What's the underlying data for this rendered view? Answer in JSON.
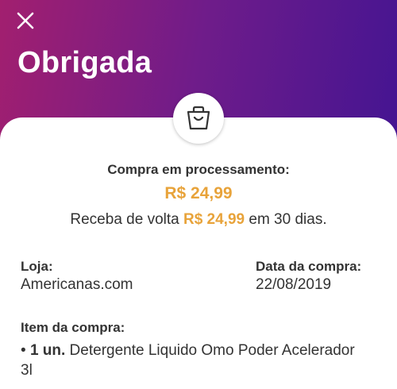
{
  "header": {
    "title": "Obrigada"
  },
  "status": {
    "label": "Compra em processamento:",
    "amount": "R$ 24,99"
  },
  "cashback": {
    "prefix": "Receba de volta ",
    "amount": "R$ 24,99",
    "suffix": " em 30 dias."
  },
  "store": {
    "label": "Loja:",
    "value": "Americanas.com"
  },
  "purchase_date": {
    "label": "Data da compra:",
    "value": "22/08/2019"
  },
  "item": {
    "label": "Item da compra:",
    "bullet": "•",
    "quantity": "1 un.",
    "description": " Detergente Liquido Omo Poder Acelerador 3l"
  },
  "icons": {
    "close": "close-icon",
    "bag": "shopping-bag-icon"
  },
  "colors": {
    "gradient_start": "#a21f6f",
    "gradient_end": "#3c1393",
    "accent": "#e8a33a",
    "text": "#333333"
  }
}
